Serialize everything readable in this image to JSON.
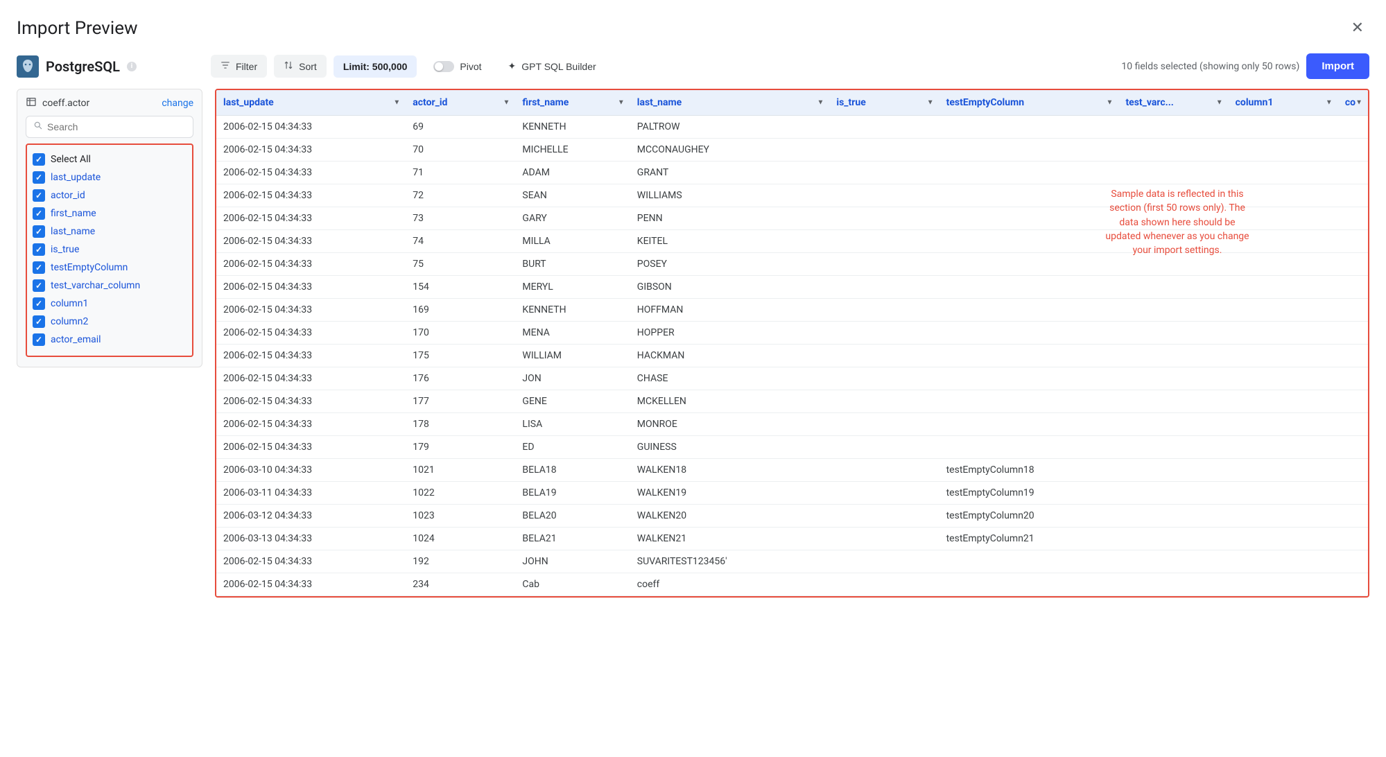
{
  "header": {
    "title": "Import Preview"
  },
  "db": {
    "name": "PostgreSQL"
  },
  "toolbar": {
    "filter": "Filter",
    "sort": "Sort",
    "limit": "Limit: 500,000",
    "pivot": "Pivot",
    "gpt": "GPT SQL Builder",
    "fields_selected": "10 fields selected (showing only 50 rows)",
    "import": "Import"
  },
  "sidebar": {
    "table_name": "coeff.actor",
    "change": "change",
    "search_placeholder": "Search",
    "select_all": "Select All",
    "fields": [
      "last_update",
      "actor_id",
      "first_name",
      "last_name",
      "is_true",
      "testEmptyColumn",
      "test_varchar_column",
      "column1",
      "column2",
      "actor_email"
    ]
  },
  "columns": [
    {
      "key": "last_update",
      "label": "last_update"
    },
    {
      "key": "actor_id",
      "label": "actor_id"
    },
    {
      "key": "first_name",
      "label": "first_name"
    },
    {
      "key": "last_name",
      "label": "last_name"
    },
    {
      "key": "is_true",
      "label": "is_true"
    },
    {
      "key": "testEmptyColumn",
      "label": "testEmptyColumn"
    },
    {
      "key": "test_varchar",
      "label": "test_varc..."
    },
    {
      "key": "column1",
      "label": "column1"
    },
    {
      "key": "column2",
      "label": "co"
    }
  ],
  "annotation": "Sample data is reflected in this section (first 50 rows only). The data shown here should be updated whenever as you change your import settings.",
  "rows": [
    {
      "last_update": "2006-02-15 04:34:33",
      "actor_id": "69",
      "first_name": "KENNETH",
      "last_name": "PALTROW",
      "is_true": "",
      "testEmptyColumn": "",
      "test_varchar": "",
      "column1": "",
      "column2": ""
    },
    {
      "last_update": "2006-02-15 04:34:33",
      "actor_id": "70",
      "first_name": "MICHELLE",
      "last_name": "MCCONAUGHEY",
      "is_true": "",
      "testEmptyColumn": "",
      "test_varchar": "",
      "column1": "",
      "column2": ""
    },
    {
      "last_update": "2006-02-15 04:34:33",
      "actor_id": "71",
      "first_name": "ADAM",
      "last_name": "GRANT",
      "is_true": "",
      "testEmptyColumn": "",
      "test_varchar": "",
      "column1": "",
      "column2": ""
    },
    {
      "last_update": "2006-02-15 04:34:33",
      "actor_id": "72",
      "first_name": "SEAN",
      "last_name": "WILLIAMS",
      "is_true": "",
      "testEmptyColumn": "",
      "test_varchar": "",
      "column1": "",
      "column2": ""
    },
    {
      "last_update": "2006-02-15 04:34:33",
      "actor_id": "73",
      "first_name": "GARY",
      "last_name": "PENN",
      "is_true": "",
      "testEmptyColumn": "",
      "test_varchar": "",
      "column1": "",
      "column2": ""
    },
    {
      "last_update": "2006-02-15 04:34:33",
      "actor_id": "74",
      "first_name": "MILLA",
      "last_name": "KEITEL",
      "is_true": "",
      "testEmptyColumn": "",
      "test_varchar": "",
      "column1": "",
      "column2": ""
    },
    {
      "last_update": "2006-02-15 04:34:33",
      "actor_id": "75",
      "first_name": "BURT",
      "last_name": "POSEY",
      "is_true": "",
      "testEmptyColumn": "",
      "test_varchar": "",
      "column1": "",
      "column2": ""
    },
    {
      "last_update": "2006-02-15 04:34:33",
      "actor_id": "154",
      "first_name": "MERYL",
      "last_name": "GIBSON",
      "is_true": "",
      "testEmptyColumn": "",
      "test_varchar": "",
      "column1": "",
      "column2": ""
    },
    {
      "last_update": "2006-02-15 04:34:33",
      "actor_id": "169",
      "first_name": "KENNETH",
      "last_name": "HOFFMAN",
      "is_true": "",
      "testEmptyColumn": "",
      "test_varchar": "",
      "column1": "",
      "column2": ""
    },
    {
      "last_update": "2006-02-15 04:34:33",
      "actor_id": "170",
      "first_name": "MENA",
      "last_name": "HOPPER",
      "is_true": "",
      "testEmptyColumn": "",
      "test_varchar": "",
      "column1": "",
      "column2": ""
    },
    {
      "last_update": "2006-02-15 04:34:33",
      "actor_id": "175",
      "first_name": "WILLIAM",
      "last_name": "HACKMAN",
      "is_true": "",
      "testEmptyColumn": "",
      "test_varchar": "",
      "column1": "",
      "column2": ""
    },
    {
      "last_update": "2006-02-15 04:34:33",
      "actor_id": "176",
      "first_name": "JON",
      "last_name": "CHASE",
      "is_true": "",
      "testEmptyColumn": "",
      "test_varchar": "",
      "column1": "",
      "column2": ""
    },
    {
      "last_update": "2006-02-15 04:34:33",
      "actor_id": "177",
      "first_name": "GENE",
      "last_name": "MCKELLEN",
      "is_true": "",
      "testEmptyColumn": "",
      "test_varchar": "",
      "column1": "",
      "column2": ""
    },
    {
      "last_update": "2006-02-15 04:34:33",
      "actor_id": "178",
      "first_name": "LISA",
      "last_name": "MONROE",
      "is_true": "",
      "testEmptyColumn": "",
      "test_varchar": "",
      "column1": "",
      "column2": ""
    },
    {
      "last_update": "2006-02-15 04:34:33",
      "actor_id": "179",
      "first_name": "ED",
      "last_name": "GUINESS",
      "is_true": "",
      "testEmptyColumn": "",
      "test_varchar": "",
      "column1": "",
      "column2": ""
    },
    {
      "last_update": "2006-03-10 04:34:33",
      "actor_id": "1021",
      "first_name": "BELA18",
      "last_name": "WALKEN18",
      "is_true": "",
      "testEmptyColumn": "testEmptyColumn18",
      "test_varchar": "",
      "column1": "",
      "column2": ""
    },
    {
      "last_update": "2006-03-11 04:34:33",
      "actor_id": "1022",
      "first_name": "BELA19",
      "last_name": "WALKEN19",
      "is_true": "",
      "testEmptyColumn": "testEmptyColumn19",
      "test_varchar": "",
      "column1": "",
      "column2": ""
    },
    {
      "last_update": "2006-03-12 04:34:33",
      "actor_id": "1023",
      "first_name": "BELA20",
      "last_name": "WALKEN20",
      "is_true": "",
      "testEmptyColumn": "testEmptyColumn20",
      "test_varchar": "",
      "column1": "",
      "column2": ""
    },
    {
      "last_update": "2006-03-13 04:34:33",
      "actor_id": "1024",
      "first_name": "BELA21",
      "last_name": "WALKEN21",
      "is_true": "",
      "testEmptyColumn": "testEmptyColumn21",
      "test_varchar": "",
      "column1": "",
      "column2": ""
    },
    {
      "last_update": "2006-02-15 04:34:33",
      "actor_id": "192",
      "first_name": "JOHN",
      "last_name": "SUVARITEST123456'",
      "is_true": "",
      "testEmptyColumn": "",
      "test_varchar": "",
      "column1": "",
      "column2": ""
    },
    {
      "last_update": "2006-02-15 04:34:33",
      "actor_id": "234",
      "first_name": "Cab",
      "last_name": "coeff",
      "is_true": "",
      "testEmptyColumn": "",
      "test_varchar": "",
      "column1": "",
      "column2": ""
    }
  ]
}
